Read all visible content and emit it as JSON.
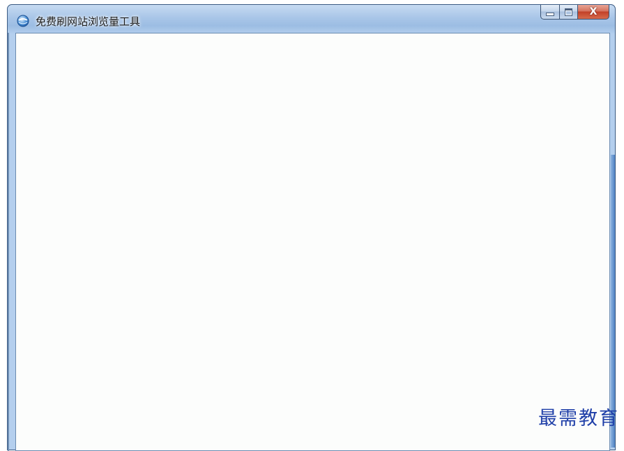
{
  "window": {
    "title": "免费刷网站浏览量工具",
    "icon": "app-globe-icon"
  },
  "caption_buttons": {
    "minimize_icon": "minimize-icon",
    "maximize_icon": "maximize-icon",
    "close_icon": "close-icon",
    "close_glyph": "X"
  },
  "watermark": {
    "text": "最需教育"
  },
  "colors": {
    "titlebar": "#a9c6e8",
    "close_button": "#c24128",
    "client_background": "#fcfdfc",
    "watermark": "#1f3fa8"
  }
}
